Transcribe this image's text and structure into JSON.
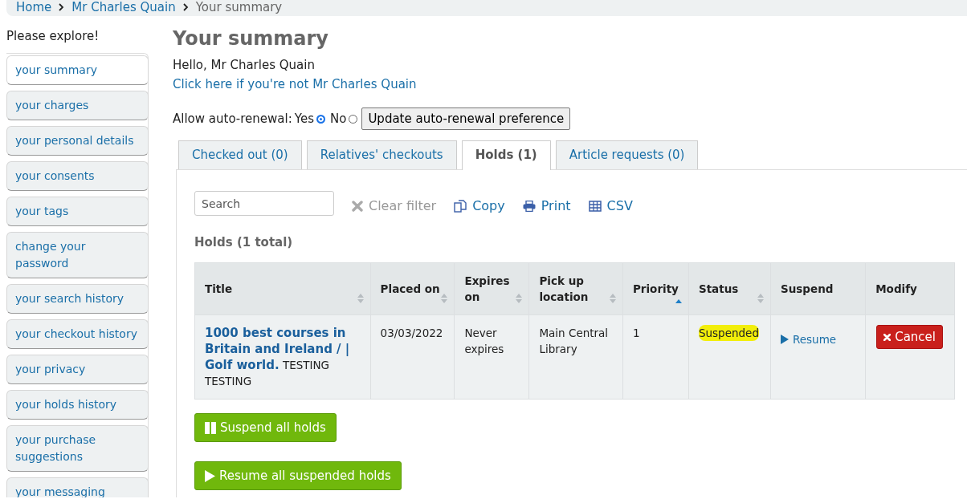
{
  "breadcrumbs": [
    {
      "label": "Home",
      "kind": "link"
    },
    {
      "label": "Mr Charles Quain",
      "kind": "link"
    },
    {
      "label": "Your summary",
      "kind": "current"
    }
  ],
  "sidebar": {
    "heading": "Please explore!",
    "items": [
      {
        "label": "your summary",
        "selected": true
      },
      {
        "label": "your charges",
        "selected": false
      },
      {
        "label": "your personal details",
        "selected": false
      },
      {
        "label": "your consents",
        "selected": false
      },
      {
        "label": "your tags",
        "selected": false
      },
      {
        "label": "change your password",
        "selected": false
      },
      {
        "label": "your search history",
        "selected": false
      },
      {
        "label": "your checkout history",
        "selected": false
      },
      {
        "label": "your privacy",
        "selected": false
      },
      {
        "label": "your holds history",
        "selected": false
      },
      {
        "label": "your purchase suggestions",
        "selected": false
      },
      {
        "label": "your messaging",
        "selected": false
      }
    ]
  },
  "page_title": "Your summary",
  "greeting": "Hello, Mr Charles Quain",
  "not_me_link": "Click here if you're not Mr Charles Quain",
  "auto_renewal": {
    "label": "Allow auto-renewal:",
    "options": [
      {
        "label": "Yes",
        "selected": true
      },
      {
        "label": "No",
        "selected": false
      }
    ],
    "button": "Update auto-renewal preference"
  },
  "tabs": [
    {
      "label": "Checked out (0)",
      "selected": false
    },
    {
      "label": "Relatives' checkouts",
      "selected": false
    },
    {
      "label": "Holds (1)",
      "selected": true
    },
    {
      "label": "Article requests (0)",
      "selected": false
    }
  ],
  "search": {
    "placeholder": "Search"
  },
  "actions": [
    {
      "label": "Clear filter",
      "kind": "clear",
      "disabled": true
    },
    {
      "label": "Copy",
      "kind": "copy",
      "disabled": false
    },
    {
      "label": "Print",
      "kind": "print",
      "disabled": false
    },
    {
      "label": "CSV",
      "kind": "csv",
      "disabled": false
    }
  ],
  "holds_heading": "Holds (1 total)",
  "table": {
    "columns": [
      {
        "label": "Title",
        "sortable": true,
        "sorted_ascending": false
      },
      {
        "label": "Placed on",
        "sortable": true,
        "sorted_ascending": false
      },
      {
        "label": "Expires on",
        "sortable": true,
        "sorted_ascending": false
      },
      {
        "label": "Pick up location",
        "sortable": true,
        "sorted_ascending": false
      },
      {
        "label": "Priority",
        "sortable": true,
        "sorted_ascending": true
      },
      {
        "label": "Status",
        "sortable": true,
        "sorted_ascending": false
      },
      {
        "label": "Suspend",
        "sortable": false,
        "sorted_ascending": false
      },
      {
        "label": "Modify",
        "sortable": false,
        "sorted_ascending": false
      }
    ],
    "rows": [
      {
        "title": "1000 best courses in Britain and Ireland / | Golf world.",
        "title_note": "TESTING TESTING",
        "placed_on": "03/03/2022",
        "expires": "Never expires",
        "pickup": "Main Central Library",
        "priority": "1",
        "status": "Suspended",
        "status_highlighted": true,
        "suspend_action": "Resume",
        "modify_action": "Cancel"
      }
    ]
  },
  "bulk_buttons": [
    {
      "label": "Suspend all holds",
      "kind": "suspend"
    },
    {
      "label": "Resume all suspended holds",
      "kind": "resume"
    }
  ]
}
